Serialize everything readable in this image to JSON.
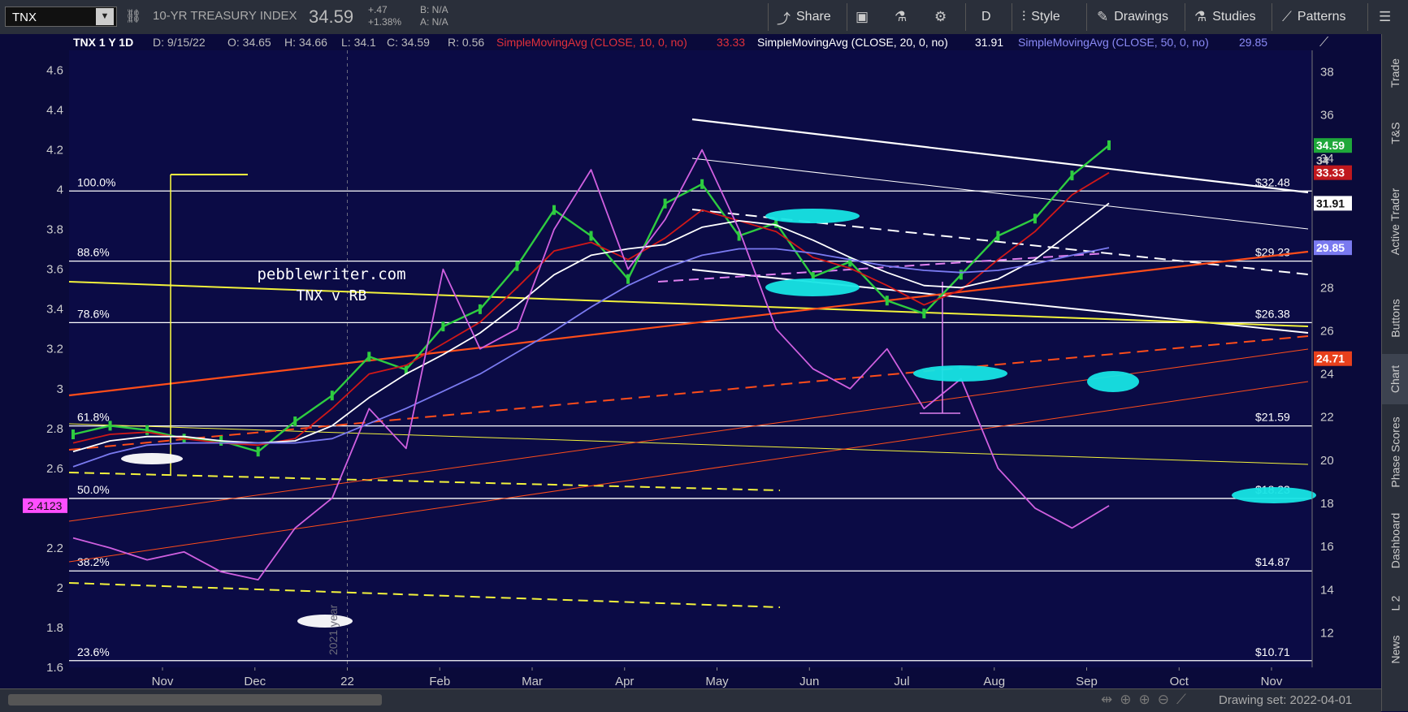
{
  "toolbar": {
    "symbol": "TNX",
    "name": "10-YR TREASURY INDEX",
    "last": "34.59",
    "change": "+.47",
    "change_pct": "+1.38%",
    "bid": "B: N/A",
    "ask": "A: N/A",
    "share": "Share",
    "period": "D",
    "style": "Style",
    "drawings": "Drawings",
    "studies": "Studies",
    "patterns": "Patterns"
  },
  "header": {
    "symbol_label": "TNX 1 Y 1D",
    "date": "D: 9/15/22",
    "open": "O: 34.65",
    "high": "H: 34.66",
    "low": "L: 34.1",
    "close": "C: 34.59",
    "range": "R: 0.56",
    "sma10_label": "SimpleMovingAvg (CLOSE, 10, 0, no)",
    "sma10_value": "33.33",
    "sma20_label": "SimpleMovingAvg (CLOSE, 20, 0, no)",
    "sma20_value": "31.91",
    "sma50_label": "SimpleMovingAvg (CLOSE, 50, 0, no)",
    "sma50_value": "29.85"
  },
  "chart_data": {
    "type": "line",
    "title": "TNX 1 Y 1D",
    "watermark_line1": "pebblewriter.com",
    "watermark_line2": "TNX v RB",
    "year_marker": "2021 year",
    "x_ticks": [
      "Nov",
      "Dec",
      "22",
      "Feb",
      "Mar",
      "Apr",
      "May",
      "Jun",
      "Jul",
      "Aug",
      "Sep",
      "Oct",
      "Nov"
    ],
    "left_axis": {
      "ticks": [
        "4.6",
        "4.4",
        "4.2",
        "4",
        "3.8",
        "3.6",
        "3.4",
        "3.2",
        "3",
        "2.8",
        "2.6",
        "2.4",
        "2.2",
        "2",
        "1.8",
        "1.6"
      ],
      "ylim": [
        1.6,
        4.7
      ],
      "current": "2.4123"
    },
    "right_axis": {
      "ticks": [
        "38",
        "36",
        "34",
        "32",
        "30",
        "28",
        "26",
        "24",
        "22",
        "20",
        "18",
        "16",
        "14",
        "12"
      ],
      "ylim": [
        10.4,
        39
      ]
    },
    "fib_levels": [
      {
        "pct": "100.0%",
        "value": "$32.48",
        "y": 32.48
      },
      {
        "pct": "88.6%",
        "value": "$29.23",
        "y": 29.23
      },
      {
        "pct": "78.6%",
        "value": "$26.38",
        "y": 26.38
      },
      {
        "pct": "61.8%",
        "value": "$21.59",
        "y": 21.59
      },
      {
        "pct": "50.0%",
        "value": "$18.23",
        "y": 18.23
      },
      {
        "pct": "38.2%",
        "value": "$14.87",
        "y": 14.87
      },
      {
        "pct": "23.6%",
        "value": "$10.71",
        "y": 10.71
      }
    ],
    "price_tags": [
      {
        "label": "34.59",
        "color": "#1fa83a"
      },
      {
        "label": "34",
        "color": ""
      },
      {
        "label": "33.33",
        "color": "#c0181e"
      },
      {
        "label": "31.91",
        "color": "#ffffff"
      },
      {
        "label": "29.85",
        "color": "#7a7af0"
      },
      {
        "label": "24.71",
        "color": "#e8401c"
      }
    ],
    "series": [
      {
        "name": "TNX",
        "color": "#2ecc40",
        "values": [
          21.2,
          21.6,
          21.4,
          21.0,
          20.9,
          20.4,
          21.8,
          23.0,
          24.8,
          24.2,
          26.2,
          27.0,
          29.0,
          31.6,
          30.4,
          28.4,
          31.9,
          32.8,
          30.4,
          31.0,
          28.5,
          29.2,
          27.4,
          26.8,
          28.6,
          30.4,
          31.2,
          33.2,
          34.6
        ]
      },
      {
        "name": "SimpleMovingAvg (CLOSE, 10, 0, no)",
        "color": "#d01818",
        "values": [
          20.8,
          21.2,
          21.3,
          21.0,
          20.8,
          20.7,
          21.0,
          22.4,
          24.0,
          24.4,
          25.4,
          26.4,
          28.0,
          29.7,
          30.1,
          29.3,
          30.3,
          31.6,
          31.1,
          30.6,
          29.4,
          28.9,
          28.1,
          27.2,
          27.9,
          29.3,
          30.6,
          32.3,
          33.33
        ]
      },
      {
        "name": "SimpleMovingAvg (CLOSE, 20, 0, no)",
        "color": "#ffffff",
        "values": [
          20.4,
          20.9,
          21.1,
          21.1,
          20.9,
          20.8,
          20.9,
          21.6,
          22.9,
          24.0,
          24.9,
          25.9,
          27.2,
          28.6,
          29.5,
          29.8,
          30.0,
          30.8,
          31.1,
          30.9,
          30.2,
          29.4,
          28.7,
          28.1,
          28.0,
          28.4,
          29.3,
          30.6,
          31.91
        ]
      },
      {
        "name": "SimpleMovingAvg (CLOSE, 50, 0, no)",
        "color": "#7a7af0",
        "values": [
          19.7,
          20.3,
          20.7,
          20.8,
          20.8,
          20.8,
          20.8,
          21.0,
          21.7,
          22.4,
          23.2,
          24.0,
          25.0,
          26.0,
          27.1,
          28.1,
          28.9,
          29.5,
          29.8,
          29.8,
          29.6,
          29.3,
          29.0,
          28.8,
          28.7,
          28.8,
          29.1,
          29.5,
          29.85
        ]
      },
      {
        "name": "RB",
        "color": "#d060e0",
        "values": [
          2.25,
          2.2,
          2.14,
          2.18,
          2.08,
          2.04,
          2.3,
          2.45,
          2.9,
          2.7,
          3.6,
          3.2,
          3.3,
          3.8,
          4.1,
          3.6,
          3.85,
          4.2,
          3.8,
          3.3,
          3.1,
          3.0,
          3.2,
          2.9,
          3.05,
          2.6,
          2.4,
          2.3,
          2.4123
        ]
      }
    ]
  }
}
